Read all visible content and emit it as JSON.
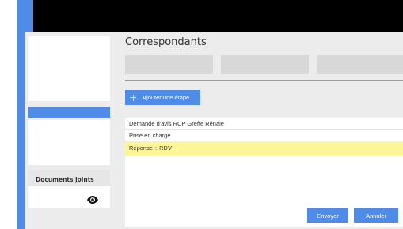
{
  "page": {
    "title": "Correspondants"
  },
  "toolbar": {
    "add_step_label": "Ajouter une étape"
  },
  "sidebar": {
    "documents_label": "Documents joints"
  },
  "steps": [
    {
      "label": "Demande d'avis RCP Greffe Rénale"
    },
    {
      "label": "Prise en charge"
    },
    {
      "label": "Réponse",
      "separator": ":",
      "value": "RDV"
    }
  ],
  "actions": {
    "send_label": "Envoyer",
    "cancel_label": "Annuler"
  },
  "icons": {
    "add": "plus-icon",
    "view": "eye-icon"
  },
  "colors": {
    "accent": "#4e8ce8",
    "highlight": "#fdf59a",
    "topbar": "#000000"
  }
}
